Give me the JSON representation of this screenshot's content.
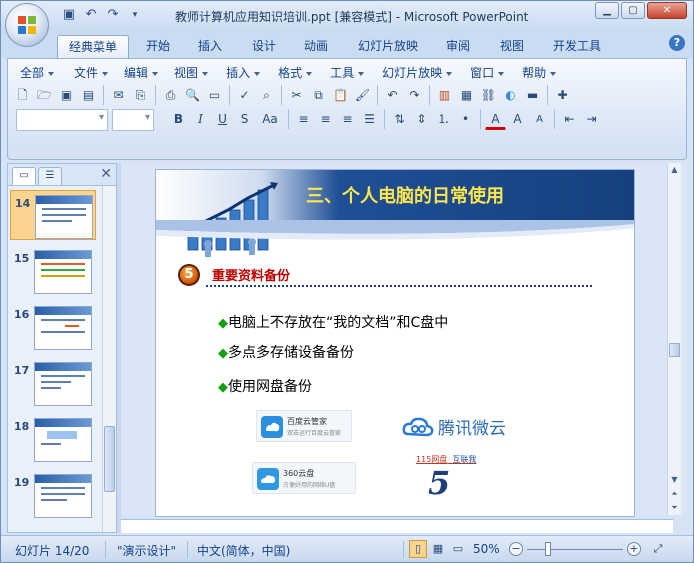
{
  "window": {
    "title": "教师计算机应用知识培训.ppt [兼容模式] - Microsoft PowerPoint",
    "controls": [
      "minimize",
      "maximize",
      "close"
    ]
  },
  "qat": {
    "icons": [
      "save-icon",
      "undo-icon",
      "redo-icon",
      "customize-icon"
    ]
  },
  "ribbon_tabs": [
    "经典菜单",
    "开始",
    "插入",
    "设计",
    "动画",
    "幻灯片放映",
    "审阅",
    "视图",
    "开发工具"
  ],
  "active_tab": "经典菜单",
  "menus": [
    "全部",
    "文件",
    "编辑",
    "视图",
    "插入",
    "格式",
    "工具",
    "幻灯片放映",
    "窗口",
    "帮助"
  ],
  "slide_panel": {
    "slides": [
      {
        "num": "14",
        "selected": true
      },
      {
        "num": "15",
        "selected": false
      },
      {
        "num": "16",
        "selected": false
      },
      {
        "num": "17",
        "selected": false
      },
      {
        "num": "18",
        "selected": false
      },
      {
        "num": "19",
        "selected": false
      }
    ]
  },
  "slide": {
    "title": "三、个人电脑的日常使用",
    "section_number": "5",
    "section_title": "重要资料备份",
    "bullets": [
      "电脑上不存放在“我的文档”和C盘中",
      "多点多存储设备备份",
      "使用网盘备份"
    ],
    "logos": {
      "baidu_title": "百度云管家",
      "baidu_sub": "双击运行百度云管家",
      "tencent": "腾讯微云",
      "qihoo_title": "360云盘",
      "qihoo_sub": "方便好用的网络U盘",
      "link1": "115网盘",
      "link2": "互联我",
      "five": "5"
    }
  },
  "status": {
    "slide_info": "幻灯片 14/20",
    "theme": "\"演示设计\"",
    "language": "中文(简体，中国)",
    "zoom": "50%"
  },
  "colors": {
    "accent": "#15428b",
    "title_yellow": "#ffe64d",
    "section_red": "#c00000",
    "bullet_green": "#11a011"
  }
}
